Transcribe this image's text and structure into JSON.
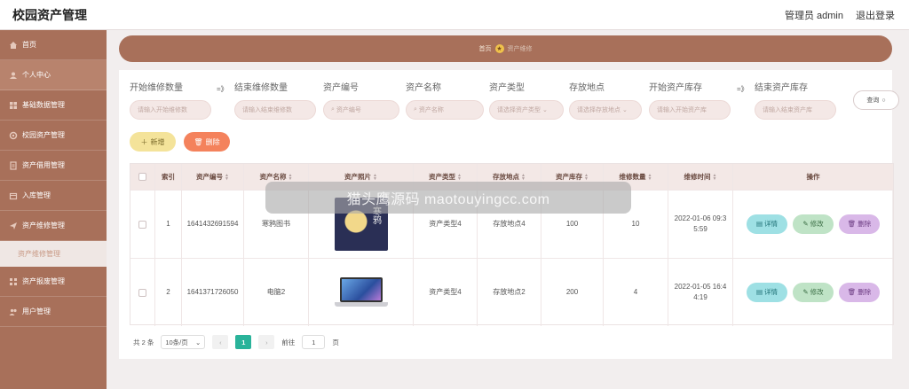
{
  "header": {
    "title": "校园资产管理",
    "user": "管理员 admin",
    "logout": "退出登录"
  },
  "sidebar": {
    "items": [
      {
        "label": "首页"
      },
      {
        "label": "个人中心"
      },
      {
        "label": "基础数据管理"
      },
      {
        "label": "校园资产管理"
      },
      {
        "label": "资产借用管理"
      },
      {
        "label": "入库管理"
      },
      {
        "label": "资产维修管理"
      }
    ],
    "sub_active": "资产维修管理",
    "items_after": [
      {
        "label": "资产报废管理"
      },
      {
        "label": "用户管理"
      }
    ]
  },
  "breadcrumb": {
    "home": "首页",
    "current": "资产维修"
  },
  "search": {
    "fields": [
      {
        "label": "开始维修数量",
        "placeholder": "请输入开始维修数"
      },
      {
        "label": "结束维修数量",
        "placeholder": "请输入结束维修数"
      },
      {
        "label": "资产编号",
        "placeholder": "资产编号"
      },
      {
        "label": "资产名称",
        "placeholder": "资产名称"
      },
      {
        "label": "资产类型",
        "placeholder": "请选择资产类型"
      },
      {
        "label": "存放地点",
        "placeholder": "请选择存放地点"
      },
      {
        "label": "开始资产库存",
        "placeholder": "请输入开始资产库"
      },
      {
        "label": "结束资产库存",
        "placeholder": "请输入结束资产库"
      }
    ],
    "range_sep": "=》",
    "query_label": "查询"
  },
  "actions": {
    "add": "新增",
    "delete": "删除"
  },
  "table": {
    "columns": [
      "索引",
      "资产编号",
      "资产名称",
      "资产照片",
      "资产类型",
      "存放地点",
      "资产库存",
      "维修数量",
      "维修时间",
      "操作"
    ],
    "rows": [
      {
        "index": "1",
        "code": "1641432691594",
        "name": "寒鸦图书",
        "photo_text": "寒鸦",
        "type": "资产类型4",
        "location": "存放地点4",
        "stock": "100",
        "repair_qty": "10",
        "repair_time": "2022-01-06 09:35:59"
      },
      {
        "index": "2",
        "code": "1641371726050",
        "name": "电脑2",
        "type": "资产类型4",
        "location": "存放地点2",
        "stock": "200",
        "repair_qty": "4",
        "repair_time": "2022-01-05 16:44:19"
      }
    ],
    "ops": {
      "detail": "详情",
      "edit": "修改",
      "remove": "删除"
    }
  },
  "pagination": {
    "total": "共 2 条",
    "page_size": "10条/页",
    "current": "1",
    "goto_label": "前往",
    "goto_value": "1",
    "page_unit": "页"
  },
  "watermark": "猫头鹰源码 maotouyingcc.com",
  "colors": {
    "sidebar": "#a8705a",
    "accent_green": "#2ab39a",
    "add": "#f4e39a",
    "delete": "#f4825c"
  }
}
